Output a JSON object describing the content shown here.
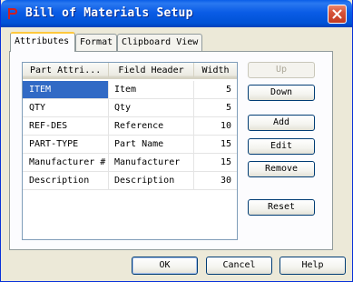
{
  "window": {
    "title": "Bill of Materials Setup"
  },
  "tabs": [
    {
      "label": "Attributes",
      "active": true
    },
    {
      "label": "Format",
      "active": false
    },
    {
      "label": "Clipboard View",
      "active": false
    }
  ],
  "table": {
    "columns": [
      "Part Attri...",
      "Field Header",
      "Width"
    ],
    "rows": [
      {
        "attribute": "ITEM",
        "header": "Item",
        "width": "5",
        "selected": true
      },
      {
        "attribute": "QTY",
        "header": "Qty",
        "width": "5"
      },
      {
        "attribute": "REF-DES",
        "header": "Reference",
        "width": "10"
      },
      {
        "attribute": "PART-TYPE",
        "header": "Part Name",
        "width": "15"
      },
      {
        "attribute": "Manufacturer #",
        "header": "Manufacturer",
        "width": "15"
      },
      {
        "attribute": "Description",
        "header": "Description",
        "width": "30"
      }
    ]
  },
  "side_buttons": {
    "up": "Up",
    "down": "Down",
    "add": "Add",
    "edit": "Edit",
    "remove": "Remove",
    "reset": "Reset"
  },
  "dialog_buttons": {
    "ok": "OK",
    "cancel": "Cancel",
    "help": "Help"
  },
  "colors": {
    "titlebar": "#0a5ce6",
    "selection": "#316ac5",
    "active_tab_accent": "#ffc83c"
  }
}
